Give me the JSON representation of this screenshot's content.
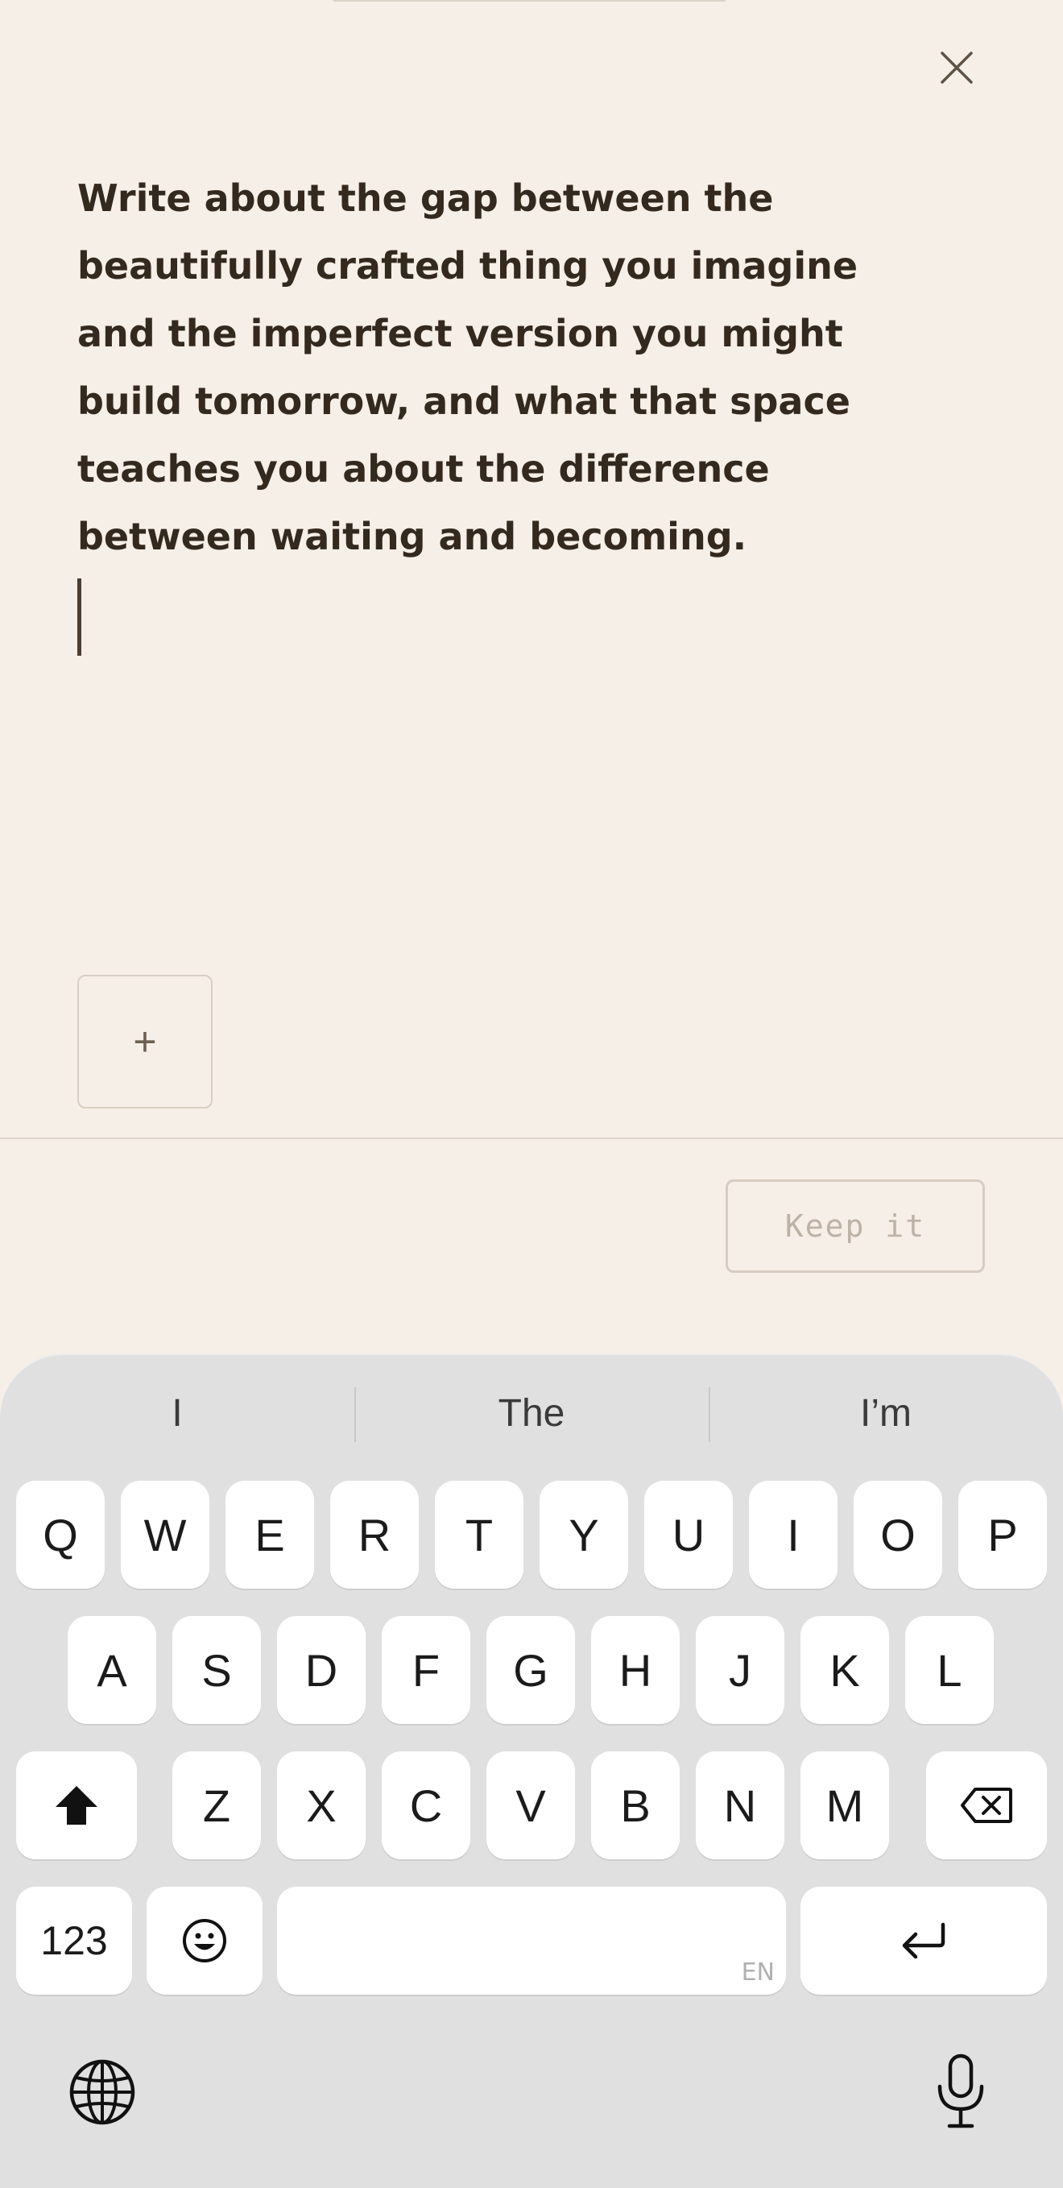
{
  "prompt": {
    "text": "Write about the gap between the beautifully crafted thing you imagine and the imperfect version you might build tomorrow, and what that space teaches you about the difference between waiting and becoming."
  },
  "editor": {
    "value": ""
  },
  "actions": {
    "add_label": "+",
    "keep_label": "Keep it"
  },
  "icons": {
    "close": "close-icon",
    "shift": "shift-icon",
    "backspace": "backspace-icon",
    "emoji": "emoji-icon",
    "enter": "enter-icon",
    "globe": "globe-icon",
    "mic": "microphone-icon"
  },
  "keyboard": {
    "suggestions": [
      "I",
      "The",
      "I’m"
    ],
    "row1": [
      "Q",
      "W",
      "E",
      "R",
      "T",
      "Y",
      "U",
      "I",
      "O",
      "P"
    ],
    "row2": [
      "A",
      "S",
      "D",
      "F",
      "G",
      "H",
      "J",
      "K",
      "L"
    ],
    "row3": [
      "Z",
      "X",
      "C",
      "V",
      "B",
      "N",
      "M"
    ],
    "numbers_label": "123",
    "space_lang": "EN"
  },
  "colors": {
    "background": "#f6efe7",
    "text": "#34291f",
    "keyboard_bg": "#e0e0e0",
    "key_bg": "#ffffff"
  }
}
